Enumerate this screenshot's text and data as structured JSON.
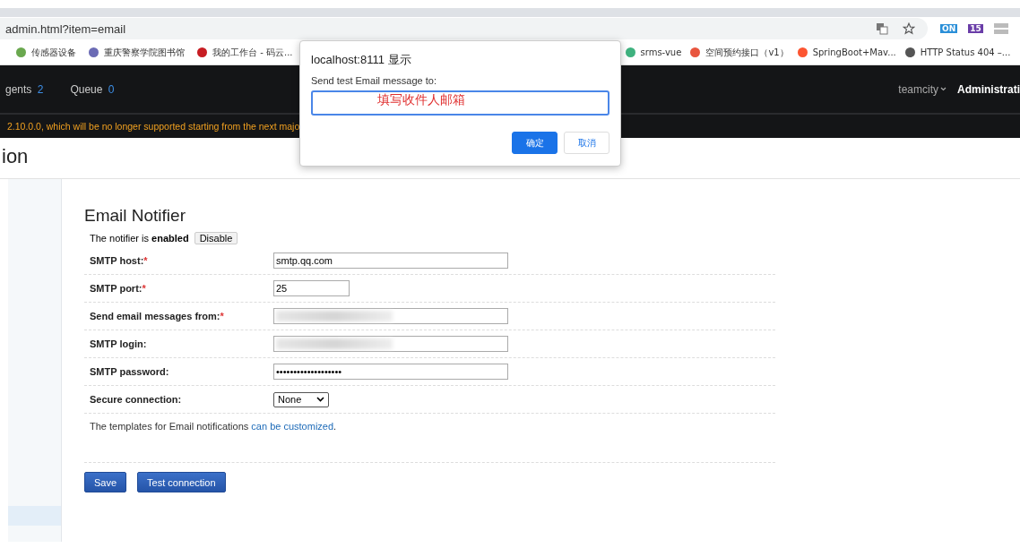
{
  "browser": {
    "url": "admin.html?item=email",
    "bookmarks": [
      {
        "label": "传感器设备",
        "color": "#6aa84f"
      },
      {
        "label": "重庆警察学院图书馆",
        "color": "#6b6bb5"
      },
      {
        "label": "我的工作台 - 码云...",
        "color": "#c71d23"
      },
      {
        "label": "srms-vue",
        "color": "#3fb27f"
      },
      {
        "label": "空间预约接口（v1）",
        "color": "#e8553e"
      },
      {
        "label": "SpringBoot+Mav...",
        "color": "#fc5531"
      },
      {
        "label": "HTTP Status 404 –...",
        "color": "#555555"
      }
    ],
    "extension_badges": [
      "ON",
      "15"
    ]
  },
  "navbar": {
    "items": [
      {
        "label": "gents",
        "count": "2"
      },
      {
        "label": "Queue",
        "count": "0"
      }
    ],
    "user": "teamcity",
    "admin": "Administrati"
  },
  "warning": "2.10.0.0, which will be no longer supported starting from the next majo",
  "page_title": "ion",
  "sidebar": {
    "items": [
      {
        "selected": true
      }
    ]
  },
  "notifier": {
    "title": "Email Notifier",
    "status_text": "The notifier is",
    "status": "enabled",
    "toggle_button": "Disable",
    "fields": [
      {
        "label": "SMTP host:",
        "required_mark": "*",
        "kind": "text",
        "value": "smtp.qq.com",
        "wide": true,
        "blurred": false
      },
      {
        "label": "SMTP port:",
        "required_mark": "*",
        "kind": "text",
        "value": "25",
        "wide": false,
        "blurred": false
      },
      {
        "label": "Send email messages from:",
        "required_mark": "*",
        "kind": "text",
        "wide": true,
        "blurred": true
      },
      {
        "label": "SMTP login:",
        "kind": "text",
        "wide": true,
        "blurred": true
      },
      {
        "label": "SMTP password:",
        "kind": "password",
        "value": "•••••••••••••••••••",
        "wide": true,
        "blurred": false
      },
      {
        "label": "Secure connection:",
        "kind": "select",
        "value": "None"
      }
    ],
    "templates_text": "The templates for Email notifications",
    "templates_link": "can be customized",
    "templates_end": ".",
    "buttons": [
      "Save",
      "Test connection"
    ]
  },
  "dialog": {
    "title": "localhost:8111 显示",
    "message": "Send test Email message to:",
    "annotation": "填写收件人邮箱",
    "buttons": [
      {
        "label": "确定",
        "primary": true
      },
      {
        "label": "取消",
        "primary": false
      }
    ]
  }
}
